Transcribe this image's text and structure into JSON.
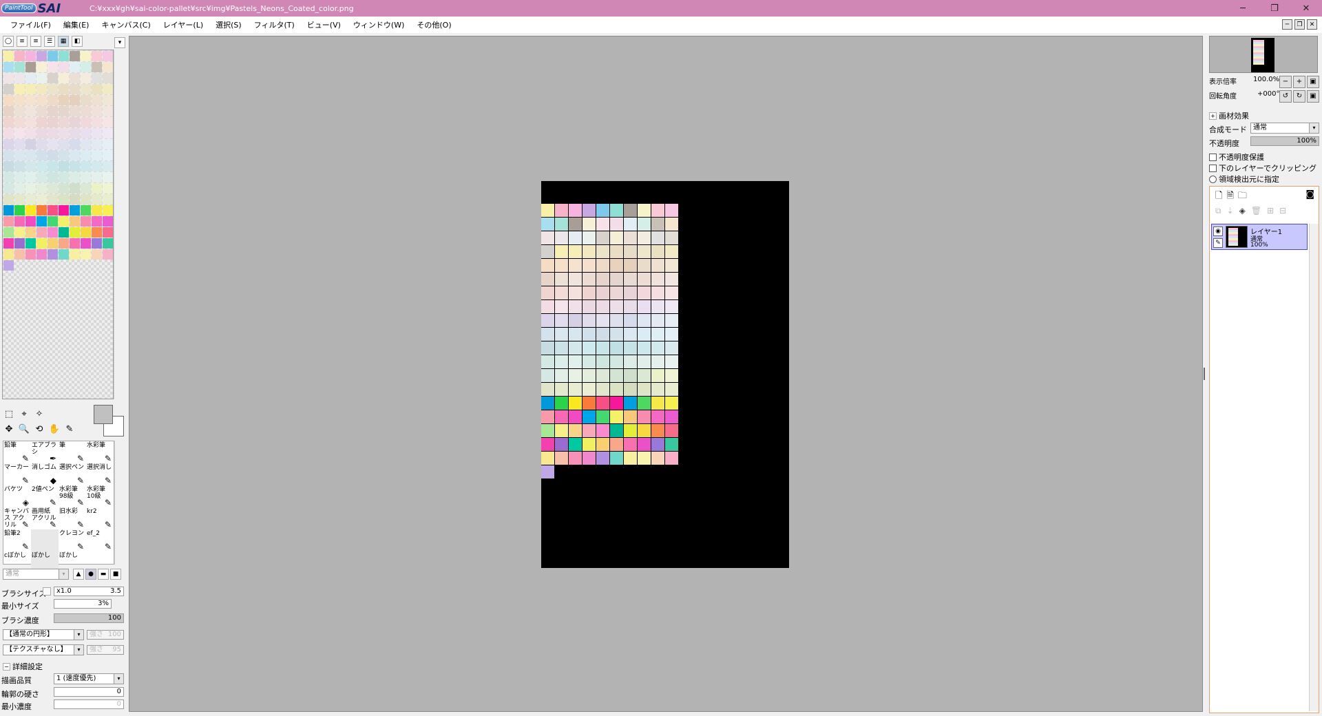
{
  "titlebar": {
    "logo_small": "PaintTool",
    "logo_big": "SAI",
    "path": "C:¥xxx¥gh¥sai-color-pallet¥src¥img¥Pastels_Neons_Coated_color.png",
    "minimize": "─",
    "maximize": "❐",
    "close": "✕"
  },
  "menu": [
    "ファイル(F)",
    "編集(E)",
    "キャンバス(C)",
    "レイヤー(L)",
    "選択(S)",
    "フィルタ(T)",
    "ビュー(V)",
    "ウィンドウ(W)",
    "その他(O)"
  ],
  "palette_colors": [
    "#f8efa8",
    "#f7b3c8",
    "#f6b3e0",
    "#c7a8e3",
    "#7cc9ec",
    "#8ee0d5",
    "#a89f96",
    "#f8f2c8",
    "#f9c9d6",
    "#f7c8e4",
    "#a8dff0",
    "#a5e3d8",
    "#a99e95",
    "#f8f0d6",
    "#f6e2e8",
    "#f2dde8",
    "#e2eef6",
    "#d6eee8",
    "#c9c0b6",
    "#f6e6d0",
    "#f1e4e6",
    "#ede6ea",
    "#e4eef2",
    "#eaf2ee",
    "#d9d2cc",
    "#f6efd8",
    "#ecdfd6",
    "#f4ece0",
    "#e0e0e0",
    "#e2ddd6",
    "#d4d0cc",
    "#f8efb4",
    "#f6edb8",
    "#f4e8c0",
    "#ece4c8",
    "#ebdcc4",
    "#e6dcc8",
    "#ede6cc",
    "#ebe0c0",
    "#f2eac4",
    "#f5dcc2",
    "#f7e0c9",
    "#f6e3cf",
    "#f4e0cc",
    "#eedac6",
    "#e8d2bc",
    "#e6d0bc",
    "#e9dcc8",
    "#f0e0cf",
    "#f2e6d4",
    "#e8d4c6",
    "#ede0d4",
    "#f0e4dc",
    "#ecdbd3",
    "#e6d3cb",
    "#e4d6cc",
    "#eadbd2",
    "#ecdcd4",
    "#f0e2da",
    "#f2e6e0",
    "#f0d4d0",
    "#f3dcd8",
    "#f4e0dc",
    "#eed3d0",
    "#ead2d0",
    "#ecd6d6",
    "#e8d4d8",
    "#f2d8dc",
    "#f4dee2",
    "#f6e4e6",
    "#f3dce4",
    "#f6e4ec",
    "#f2e0e8",
    "#ead8e2",
    "#ecdae4",
    "#eedee8",
    "#e8dce8",
    "#eadff0",
    "#ece4f2",
    "#f0e8f4",
    "#dcd4ea",
    "#e2dcef",
    "#d6d0e6",
    "#e0dcec",
    "#e6e2f0",
    "#dee0ee",
    "#d6dcee",
    "#e0e6f2",
    "#e4eaf4",
    "#e6eef6",
    "#d4e2ee",
    "#dae6f0",
    "#d8e6f0",
    "#d2e0ec",
    "#d0dce8",
    "#d4e2ec",
    "#dae8f2",
    "#dcecf4",
    "#e0eef6",
    "#e4f0f8",
    "#c6dce2",
    "#cce2e8",
    "#d4e8ec",
    "#ceeaee",
    "#c6e6ea",
    "#c0e0e6",
    "#c6e4e8",
    "#cce8ec",
    "#d2eaee",
    "#d8ecf0",
    "#d4e8e4",
    "#dceeea",
    "#e0f0ec",
    "#d6ebe6",
    "#cee6e0",
    "#d2e8e2",
    "#dcede8",
    "#e0efea",
    "#e4f0ec",
    "#e8f2ee",
    "#d6e8e4",
    "#e2efe6",
    "#e8f2e4",
    "#e4eedc",
    "#dde8d6",
    "#d4e4d2",
    "#d0dfcc",
    "#dae8d4",
    "#ecf2c8",
    "#f0f4d4",
    "#e0e4c8",
    "#e4e8cc",
    "#e8ecd0",
    "#eceed4",
    "#e2e6ca",
    "#dce2c4",
    "#d6dcc0",
    "#e0e4c6",
    "#e6eacc",
    "#eaeed0",
    "#0098d8",
    "#2bd34a",
    "#f9e820",
    "#f97b3c",
    "#f74f86",
    "#f8169b",
    "#00a0e0",
    "#4fd860",
    "#f7e84a",
    "#f8f050",
    "#f99aa8",
    "#f769b4",
    "#f24ac2",
    "#00a6e8",
    "#44d870",
    "#f5f06a",
    "#f9c87a",
    "#f98ab0",
    "#f569c4",
    "#ec5bd0",
    "#a8e894",
    "#f6f08a",
    "#f9d488",
    "#f9a8b8",
    "#f98ad0",
    "#00b894",
    "#e2ee38",
    "#f7d840",
    "#f98a50",
    "#f76c8a",
    "#f43fb0",
    "#9a6cd0",
    "#00c8a0",
    "#f0f060",
    "#f8d070",
    "#f8a888",
    "#f870b0",
    "#ea50c8",
    "#9878d8",
    "#38c8a0",
    "#f8e890",
    "#f8c0a8",
    "#f890b8",
    "#f088d0",
    "#b090e0",
    "#70d8c8",
    "#f8f0a0",
    "#f8f4b0",
    "#f8d4b8",
    "#f8b0c8",
    "#c0a8e8"
  ],
  "tools_row1": [
    "⬚",
    "⌖",
    "✧"
  ],
  "tools_row2": [
    "✥",
    "🔍",
    "⟲",
    "✋",
    "✎"
  ],
  "brushes": [
    {
      "label": "鉛筆",
      "icon": "✎"
    },
    {
      "label": "エアブラシ",
      "icon": "✒"
    },
    {
      "label": "筆",
      "icon": "✎"
    },
    {
      "label": "水彩筆",
      "icon": "✎"
    },
    {
      "label": "マーカー",
      "icon": "✎"
    },
    {
      "label": "消しゴム",
      "icon": "◆"
    },
    {
      "label": "選択ペン",
      "icon": "✎"
    },
    {
      "label": "選択消し",
      "icon": "✎"
    },
    {
      "label": "バケツ",
      "icon": "◈"
    },
    {
      "label": "2値ペン",
      "icon": "✎"
    },
    {
      "label": "水彩筆 98級",
      "icon": "✎"
    },
    {
      "label": "水彩筆 10級",
      "icon": "✎"
    },
    {
      "label": "キャンバス アクリル",
      "icon": "✎"
    },
    {
      "label": "画用紙 アクリル",
      "icon": "✎"
    },
    {
      "label": "旧水彩",
      "icon": "✎"
    },
    {
      "label": "kr2",
      "icon": "✎"
    },
    {
      "label": "鉛筆2",
      "icon": "✎"
    },
    {
      "label": "",
      "icon": ""
    },
    {
      "label": "クレヨン",
      "icon": "✎"
    },
    {
      "label": "ef_2",
      "icon": "✎"
    },
    {
      "label": "cぼかし",
      "icon": ""
    },
    {
      "label": "ぼかし",
      "icon": ""
    },
    {
      "label": "ぼかし",
      "icon": ""
    },
    {
      "label": "",
      "icon": ""
    }
  ],
  "brush_settings": {
    "blend_mode": "通常",
    "brush_size_label": "ブラシサイズ",
    "brush_size_mult": "x1.0",
    "brush_size_value": "3.5",
    "min_size_label": "最小サイズ",
    "min_size_value": "3%",
    "density_label": "ブラシ濃度",
    "density_value": "100",
    "shape_select": "【通常の円形】",
    "shape_strength_label": "強さ",
    "shape_strength": "100",
    "texture_select": "【テクスチャなし】",
    "texture_strength_label": "強さ",
    "texture_strength": "95",
    "detail_label": "詳細設定",
    "quality_label": "描画品質",
    "quality_value": "1 (速度優先)",
    "edge_label": "輪郭の硬さ",
    "edge_value": "0",
    "min_density_label": "最小濃度",
    "min_density_value": "0"
  },
  "navigator": {
    "zoom_label": "表示倍率",
    "zoom_value": "100.0%",
    "rotate_label": "回転角度",
    "rotate_value": "+000°"
  },
  "layer_props": {
    "paper_effect": "画材効果",
    "blend_label": "合成モード",
    "blend_value": "通常",
    "opacity_label": "不透明度",
    "opacity_value": "100%",
    "protect_opacity": "不透明度保護",
    "clip_below": "下のレイヤーでクリッピング",
    "selection_source": "領域検出元に指定"
  },
  "layers": [
    {
      "name": "レイヤー1",
      "mode": "通常",
      "opacity": "100%"
    }
  ]
}
